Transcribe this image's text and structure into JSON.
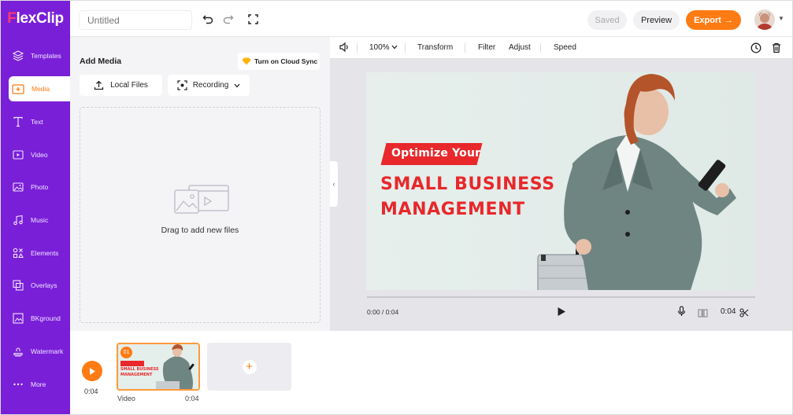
{
  "app": {
    "logo_text": "FlexClip",
    "title_placeholder": "Untitled",
    "saved_label": "Saved",
    "preview_label": "Preview",
    "export_label": "Export",
    "colors": {
      "brand": "#7a1fd8",
      "accent": "#ff7b13",
      "headline_red": "#e8282b"
    }
  },
  "sidebar": {
    "items": [
      {
        "label": "Templates",
        "icon": "layers-icon"
      },
      {
        "label": "Media",
        "icon": "media-icon"
      },
      {
        "label": "Text",
        "icon": "text-icon"
      },
      {
        "label": "Video",
        "icon": "video-icon"
      },
      {
        "label": "Photo",
        "icon": "photo-icon"
      },
      {
        "label": "Music",
        "icon": "music-icon"
      },
      {
        "label": "Elements",
        "icon": "elements-icon"
      },
      {
        "label": "Overlays",
        "icon": "overlays-icon"
      },
      {
        "label": "BKground",
        "icon": "background-icon"
      },
      {
        "label": "Watermark",
        "icon": "stamp-icon"
      },
      {
        "label": "More",
        "icon": "more-icon"
      }
    ],
    "active": "Media"
  },
  "media_panel": {
    "title": "Add Media",
    "cloud_sync_label": "Turn on Cloud Sync",
    "local_files_label": "Local Files",
    "recording_label": "Recording",
    "drop_text": "Drag to add new files"
  },
  "editor_toolbar": {
    "zoom": "100%",
    "transform": "Transform",
    "filter": "Filter",
    "adjust": "Adjust",
    "speed": "Speed"
  },
  "canvas": {
    "tag_text": "Optimize Your",
    "headline_line1": "SMALL BUSINESS",
    "headline_line2": "MANAGEMENT"
  },
  "player": {
    "timecode": "0:00 / 0:04",
    "duration": "0:04"
  },
  "timeline": {
    "total_time": "0:04",
    "clip_number": "01",
    "clip_thumb_line1": "SMALL BUSINESS",
    "clip_thumb_line2": "MANAGEMENT",
    "clip_label": "Video",
    "clip_duration": "0:04"
  }
}
